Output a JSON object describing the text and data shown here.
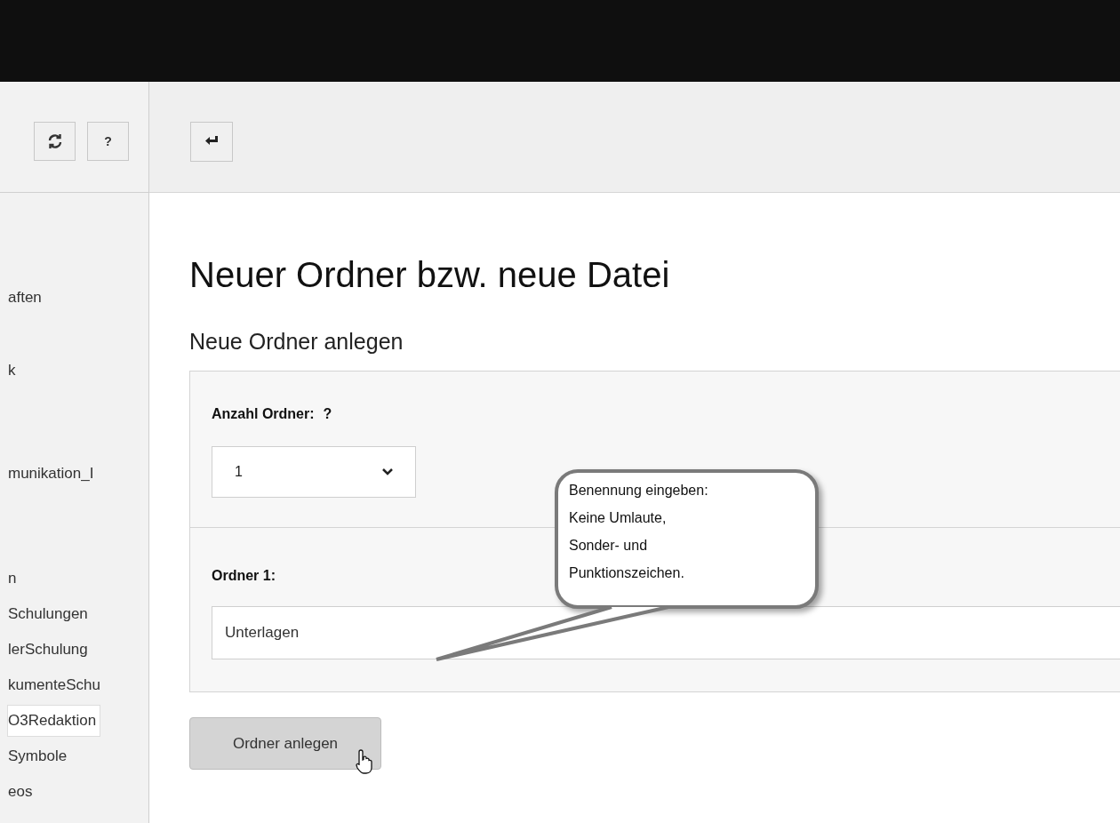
{
  "sidebar": {
    "toolbar": [
      {
        "kind": "refresh"
      },
      {
        "kind": "help",
        "label": "?"
      }
    ],
    "items": [
      {
        "label": "aften",
        "selected": false
      },
      {
        "label": "k",
        "selected": false
      },
      {
        "label": "munikation_I",
        "selected": false
      },
      {
        "label": "n",
        "selected": false
      },
      {
        "label": "Schulungen",
        "selected": false
      },
      {
        "label": "lerSchulung",
        "selected": false
      },
      {
        "label": "kumenteSchu",
        "selected": false
      },
      {
        "label": "O3Redaktion",
        "selected": true
      },
      {
        "label": "Symbole",
        "selected": false
      },
      {
        "label": "eos",
        "selected": false
      }
    ]
  },
  "main": {
    "toolbar": [
      {
        "kind": "return"
      }
    ],
    "title": "Neuer Ordner bzw. neue Datei",
    "subtitle": "Neue Ordner anlegen",
    "count_field": {
      "label": "Anzahl Ordner:",
      "help": "?",
      "value": "1"
    },
    "folder_field": {
      "label": "Ordner 1:",
      "value": "Unterlagen"
    },
    "submit": "Ordner anlegen",
    "callout": [
      "Benennung eingeben:",
      "Keine Umlaute,",
      "Sonder- und",
      "Punktionszeichen."
    ]
  }
}
